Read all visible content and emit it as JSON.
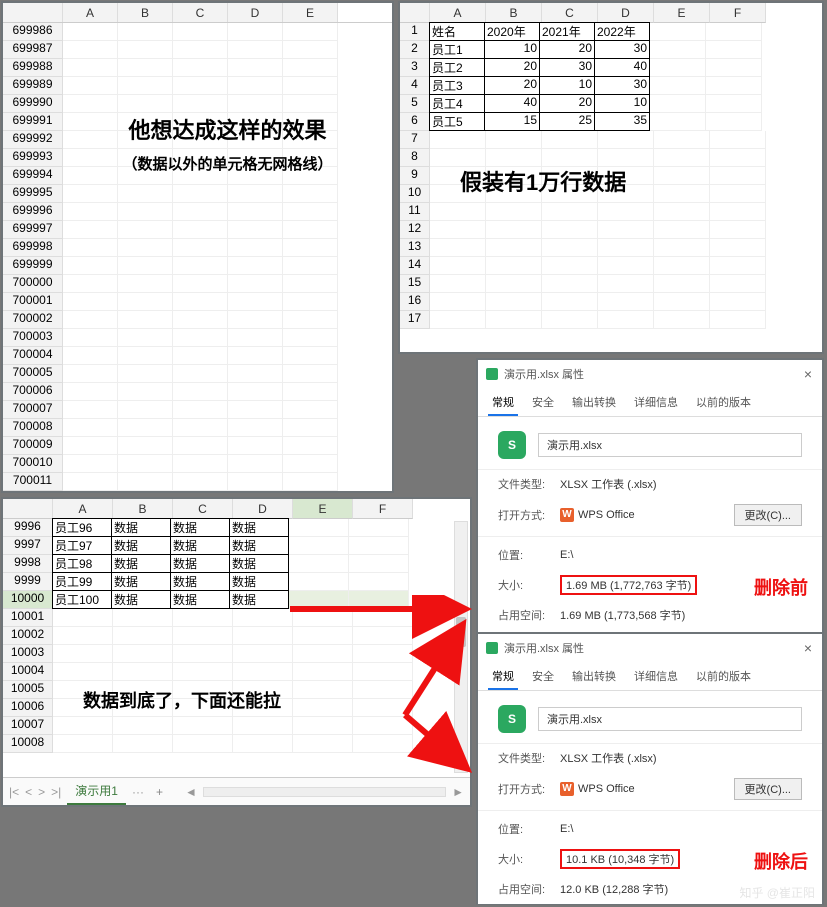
{
  "panel1": {
    "cols": [
      "A",
      "B",
      "C",
      "D",
      "E"
    ],
    "rows": [
      "699986",
      "699987",
      "699988",
      "699989",
      "699990",
      "699991",
      "699992",
      "699993",
      "699994",
      "699995",
      "699996",
      "699997",
      "699998",
      "699999",
      "700000",
      "700001",
      "700002",
      "700003",
      "700004",
      "700005",
      "700006",
      "700007",
      "700008",
      "700009",
      "700010",
      "700011"
    ],
    "overlay_title": "他想达成这样的效果",
    "overlay_sub": "（数据以外的单元格无网格线）"
  },
  "panel2": {
    "cols": [
      "A",
      "B",
      "C",
      "D",
      "E",
      "F"
    ],
    "rownums": [
      "1",
      "2",
      "3",
      "4",
      "5",
      "6",
      "7",
      "8",
      "9",
      "10",
      "11",
      "12",
      "13",
      "14",
      "15",
      "16",
      "17"
    ],
    "header": [
      "姓名",
      "2020年",
      "2021年",
      "2022年"
    ],
    "data": [
      [
        "员工1",
        "10",
        "20",
        "30"
      ],
      [
        "员工2",
        "20",
        "30",
        "40"
      ],
      [
        "员工3",
        "20",
        "10",
        "30"
      ],
      [
        "员工4",
        "40",
        "20",
        "10"
      ],
      [
        "员工5",
        "15",
        "25",
        "35"
      ]
    ],
    "overlay": "假装有1万行数据"
  },
  "panel3": {
    "cols": [
      "A",
      "B",
      "C",
      "D",
      "E",
      "F"
    ],
    "blank_rows": [
      "10001",
      "10002",
      "10003",
      "10004",
      "10005",
      "10006",
      "10007",
      "10008"
    ],
    "data": [
      {
        "n": "9996",
        "r": [
          "员工96",
          "数据",
          "数据",
          "数据"
        ]
      },
      {
        "n": "9997",
        "r": [
          "员工97",
          "数据",
          "数据",
          "数据"
        ]
      },
      {
        "n": "9998",
        "r": [
          "员工98",
          "数据",
          "数据",
          "数据"
        ]
      },
      {
        "n": "9999",
        "r": [
          "员工99",
          "数据",
          "数据",
          "数据"
        ]
      },
      {
        "n": "10000",
        "r": [
          "员工100",
          "数据",
          "数据",
          "数据"
        ]
      }
    ],
    "overlay": "数据到底了，下面还能拉",
    "tab": "演示用1",
    "plus": "+"
  },
  "dlg": {
    "title": "演示用.xlsx 属性",
    "tabs": [
      "常规",
      "安全",
      "输出转换",
      "详细信息",
      "以前的版本"
    ],
    "filename": "演示用.xlsx",
    "filetype_label": "文件类型:",
    "filetype_val": "XLSX 工作表 (.xlsx)",
    "openwith_label": "打开方式:",
    "openwith_val": "WPS Office",
    "change_btn": "更改(C)...",
    "loc_label": "位置:",
    "loc_val": "E:\\",
    "size_label": "大小:",
    "disk_label": "占用空间:",
    "before": {
      "size": "1.69 MB (1,772,763 字节)",
      "disk": "1.69 MB (1,773,568 字节)",
      "tag": "删除前"
    },
    "after": {
      "size": "10.1 KB (10,348 字节)",
      "disk": "12.0 KB (12,288 字节)",
      "tag": "删除后"
    }
  },
  "chart_data": {
    "type": "table",
    "title": "员工年度数据",
    "columns": [
      "姓名",
      "2020年",
      "2021年",
      "2022年"
    ],
    "rows": [
      [
        "员工1",
        10,
        20,
        30
      ],
      [
        "员工2",
        20,
        30,
        40
      ],
      [
        "员工3",
        20,
        10,
        30
      ],
      [
        "员工4",
        40,
        20,
        10
      ],
      [
        "员工5",
        15,
        25,
        35
      ]
    ]
  },
  "watermark": "知乎 @崔正阳"
}
